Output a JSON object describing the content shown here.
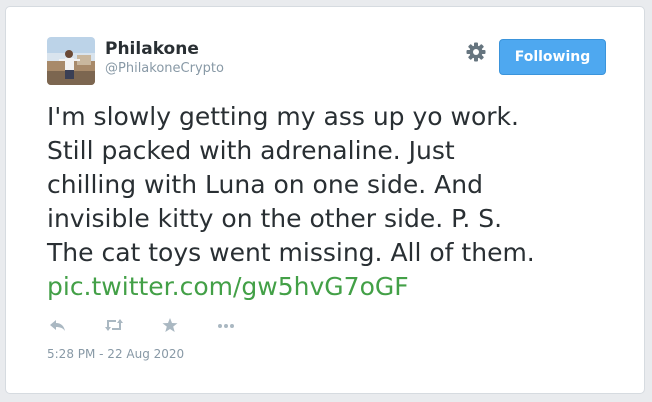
{
  "user": {
    "display_name": "Philakone",
    "handle": "@PhilakoneCrypto",
    "avatar_icon": "profile-photo"
  },
  "follow_button": {
    "label": "Following",
    "color": "#4ea8f0"
  },
  "settings_icon": "gear-icon",
  "tweet": {
    "lines": [
      "I'm slowly getting my ass up yo work.",
      "Still packed with adrenaline. Just",
      "chilling with Luna on one side. And",
      "invisible kitty on the other side. P. S.",
      "The cat toys went missing. All of them."
    ],
    "link": "pic.twitter.com/gw5hvG7oGF",
    "link_color": "#43a047"
  },
  "actions": {
    "icons": [
      "reply-icon",
      "retweet-icon",
      "like-icon",
      "more-icon"
    ]
  },
  "timestamp": "5:28 PM - 22 Aug 2020"
}
